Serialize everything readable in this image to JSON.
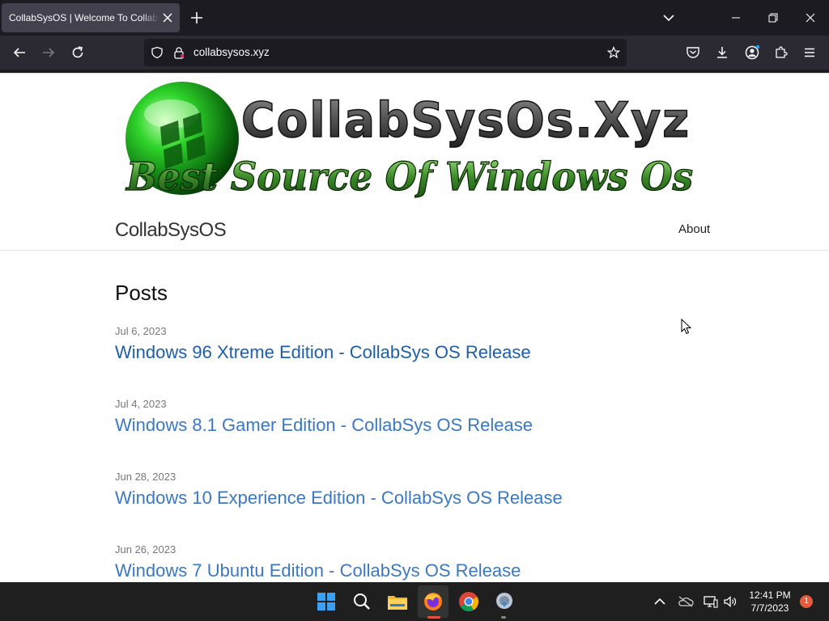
{
  "browser": {
    "tab": {
      "title": "CollabSysOS | Welcome To CollabSysOS"
    },
    "url": "collabsysos.xyz"
  },
  "page": {
    "banner": {
      "line1": "CollabSysOs.Xyz",
      "line2": "Best Source Of Windows Os"
    },
    "site_title": "CollabSysOS",
    "nav": {
      "about": "About"
    },
    "posts_heading": "Posts",
    "posts": [
      {
        "date": "Jul 6, 2023",
        "title": "Windows 96 Xtreme Edition - CollabSys OS Release"
      },
      {
        "date": "Jul 4, 2023",
        "title": "Windows 8.1 Gamer Edition - CollabSys OS Release"
      },
      {
        "date": "Jun 28, 2023",
        "title": "Windows 10 Experience Edition - CollabSys OS Release"
      },
      {
        "date": "Jun 26, 2023",
        "title": "Windows 7 Ubuntu Edition - CollabSys OS Release"
      }
    ]
  },
  "taskbar": {
    "time": "12:41 PM",
    "date": "7/7/2023",
    "notifications": "1"
  },
  "colors": {
    "link": "#1d5eaa",
    "banner_green": "#2bbf2b",
    "taskbar": "#1f1f1f"
  }
}
